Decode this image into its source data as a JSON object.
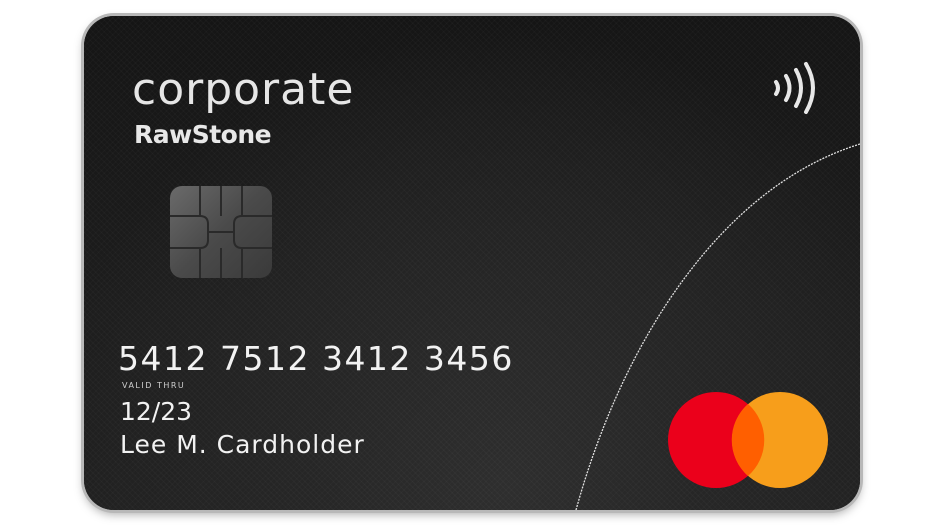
{
  "card": {
    "brand_primary": "corporate",
    "brand_secondary": "RawStone",
    "card_number": "5412 7512 3412 3456",
    "valid_thru_label": "VALID THRU",
    "expiry": "12/23",
    "cardholder_name": "Lee M. Cardholder"
  },
  "colors": {
    "card_background": "#1b1b1b",
    "text": "#f2f2f2",
    "accent_dot_corporate": "#9a9a9a",
    "accent_dot_rawstone": "#f2c200",
    "mastercard_red": "#eb001b",
    "mastercard_orange": "#f79e1b",
    "mastercard_overlap": "#ff5f00"
  },
  "icons": {
    "contactless": "contactless-icon",
    "chip": "emv-chip-icon",
    "network_logo": "mastercard-logo"
  }
}
